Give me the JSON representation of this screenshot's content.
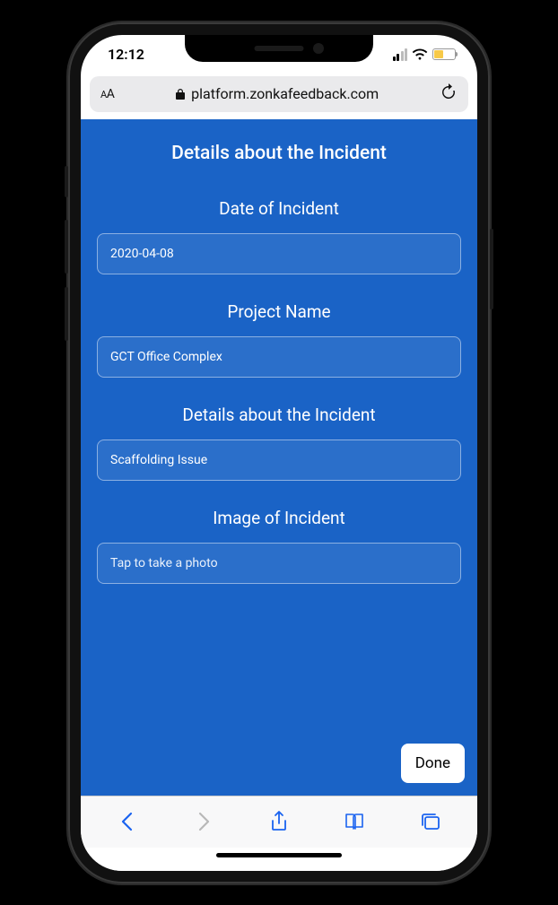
{
  "status": {
    "time": "12:12"
  },
  "browser": {
    "url_display": "platform.zonkafeedback.com"
  },
  "form": {
    "title": "Details about the Incident",
    "date_label": "Date of Incident",
    "date_value": "2020-04-08",
    "project_label": "Project Name",
    "project_value": "GCT Office Complex",
    "details_label": "Details about the Incident",
    "details_value": "Scaffolding Issue",
    "image_label": "Image of Incident",
    "image_placeholder": "Tap to take a photo",
    "done_label": "Done"
  }
}
